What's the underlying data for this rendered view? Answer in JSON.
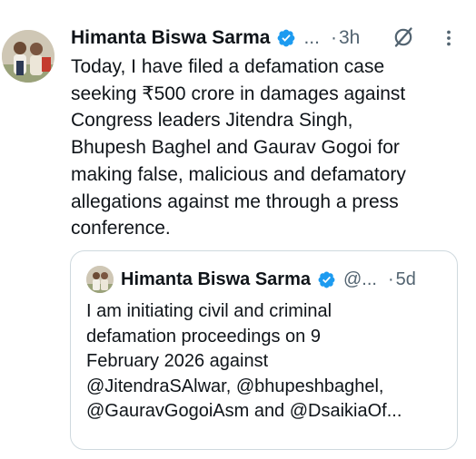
{
  "tweet": {
    "author_name": "Himanta Biswa Sarma",
    "handle": "...",
    "separator": "·",
    "time": "3h",
    "body_lines": [
      "Today, I have filed a defamation case",
      "seeking ₹500 crore in damages against",
      "Congress leaders Jitendra Singh,",
      "Bhupesh Baghel and Gaurav Gogoi for",
      "making false, malicious and defamatory",
      "allegations against me through a press",
      "conference."
    ]
  },
  "quoted_tweet": {
    "author_name": "Himanta Biswa Sarma",
    "handle": "@...",
    "separator": "·",
    "time": "5d",
    "body_lines": [
      "I am initiating civil and criminal",
      "defamation proceedings on 9",
      "February 2026 against",
      "@JitendraSAlwar, @bhupeshbaghel,",
      "@GauravGogoiAsm and @DsaikiaOf..."
    ]
  },
  "icons": {
    "verified": "verified-badge-icon",
    "grok": "grok-icon",
    "more": "more-options-icon"
  },
  "colors": {
    "text": "#0f1419",
    "secondary": "#536471",
    "verified": "#1d9bf0",
    "border": "#cfd9de"
  }
}
